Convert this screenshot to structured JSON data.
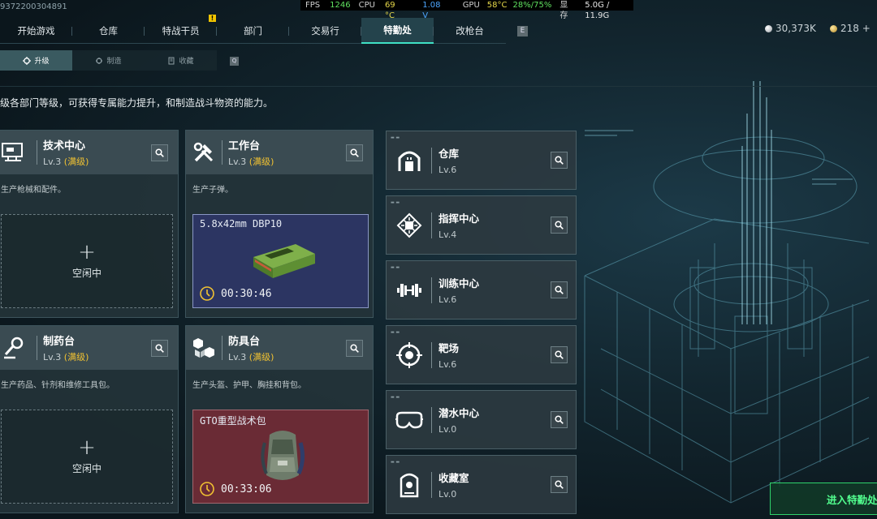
{
  "uid": "9372200304891",
  "perf": {
    "fps_label": "FPS",
    "fps": "1246",
    "cpu_label": "CPU",
    "cpu_temp": "69 °C",
    "cpu_volt": "1.08 V",
    "gpu_label": "GPU",
    "gpu_temp": "58°C",
    "gpu_load": "28%/75%",
    "vram_label": "显存",
    "vram": "5.0G / 11.9G"
  },
  "notif_badge": "!",
  "topnav": {
    "tabs": [
      "开始游戏",
      "仓库",
      "特战干员",
      "部门",
      "交易行",
      "特勤处",
      "改枪台"
    ],
    "active": "特勤处",
    "key_hint": "E"
  },
  "currency": {
    "silver": "30,373K",
    "gold": "218 +",
    "silver_color": "#c8ccd0",
    "gold_color": "#d7b04a"
  },
  "subnav": {
    "tabs": [
      "升级",
      "制造",
      "收藏"
    ],
    "icons": [
      "gear-up-icon",
      "wrench-icon",
      "collection-icon"
    ],
    "active": "升级",
    "key_hint": "Q"
  },
  "description": "级各部门等级，可获得专属能力提升，和制造战斗物资的能力。",
  "cards": [
    {
      "name": "技术中心",
      "level": "Lv.3",
      "max": "(满级)",
      "desc": "生产枪械和配件。",
      "icon": "tech-center-icon",
      "state": "idle",
      "idle_text": "空闲中"
    },
    {
      "name": "工作台",
      "level": "Lv.3",
      "max": "(满级)",
      "desc": "生产子弹。",
      "icon": "workbench-icon",
      "state": "producing",
      "item": "5.8x42mm DBP10",
      "time": "00:30:46",
      "item_icon": "ammo-box-icon",
      "bg": "#2c3562"
    },
    {
      "name": "制药台",
      "level": "Lv.3",
      "max": "(满级)",
      "desc": "生产药品、针剂和维修工具包。",
      "icon": "pharmacy-icon",
      "state": "idle",
      "idle_text": "空闲中"
    },
    {
      "name": "防具台",
      "level": "Lv.3",
      "max": "(满级)",
      "desc": "生产头盔、护甲、胸挂和背包。",
      "icon": "armor-bench-icon",
      "state": "producing",
      "item": "GTO重型战术包",
      "time": "00:33:06",
      "item_icon": "backpack-icon",
      "bg": "#6a2b35"
    }
  ],
  "right_cards": [
    {
      "name": "仓库",
      "level": "Lv.6",
      "icon": "warehouse-icon"
    },
    {
      "name": "指挥中心",
      "level": "Lv.4",
      "icon": "command-center-icon"
    },
    {
      "name": "训练中心",
      "level": "Lv.6",
      "icon": "dumbbell-icon"
    },
    {
      "name": "靶场",
      "level": "Lv.6",
      "icon": "target-icon"
    },
    {
      "name": "潜水中心",
      "level": "Lv.0",
      "icon": "diving-mask-icon"
    },
    {
      "name": "收藏室",
      "level": "Lv.0",
      "icon": "collection-room-icon"
    }
  ],
  "enter_button": "进入特勤处",
  "accent": "#3fe0c4"
}
